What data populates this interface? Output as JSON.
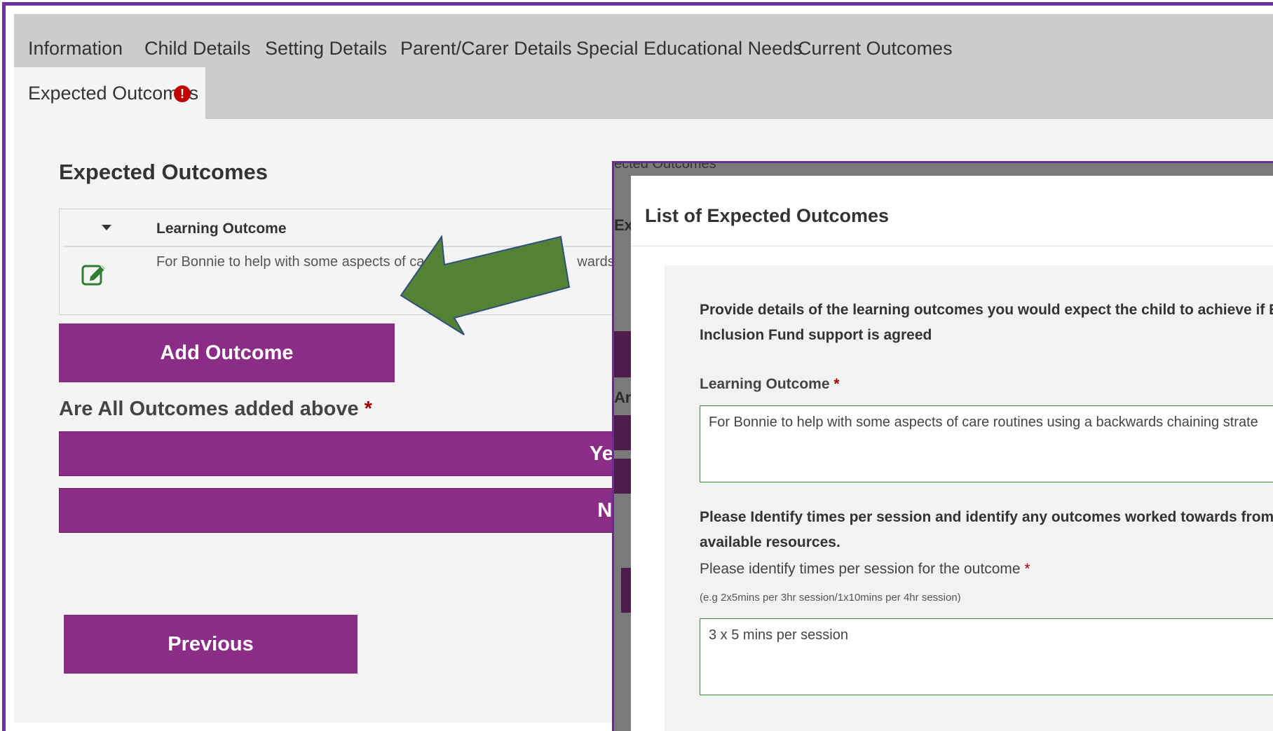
{
  "tabs": {
    "information": "Information",
    "child_details": "Child Details",
    "setting_details": "Setting Details",
    "parent_carer_details": "Parent/Carer Details",
    "special_educational_needs": "Special Educational Needs",
    "current_outcomes": "Current Outcomes",
    "expected_outcomes": "Expected Outcomes"
  },
  "main": {
    "section_title": "Expected Outcomes",
    "table": {
      "column_header": "Learning Outcome",
      "row_text_start": "For Bonnie to help with some aspects of ca",
      "row_text_end": "wards"
    },
    "add_outcome_label": "Add Outcome",
    "question": "Are All Outcomes added above",
    "required_mark": "*",
    "yes_label": "Yes",
    "no_label": "No",
    "previous_label": "Previous"
  },
  "background_peek": {
    "tab_fragment": "ected Outcomes",
    "ex_fragment": "Ex",
    "ar_fragment": "Ar"
  },
  "modal": {
    "title": "List of Expected Outcomes",
    "intro_line1": "Provide details of the learning outcomes you would expect the child to achieve if Earl",
    "intro_line2": "Inclusion Fund support is agreed",
    "learning_outcome_label": "Learning Outcome",
    "learning_outcome_value": "For Bonnie to help with some aspects of care routines using a backwards chaining strate",
    "times_heading_line1": "Please Identify times per session and identify any outcomes worked towards from no",
    "times_heading_line2": "available resources.",
    "times_label": "Please identify times per session for the outcome",
    "times_hint": "(e.g 2x5mins per 3hr session/1x10mins per 4hr session)",
    "times_value": "3 x 5 mins per session"
  },
  "colors": {
    "accent_purple": "#8b2d87",
    "frame_purple": "#7030a0",
    "arrow_green": "#548235",
    "alert_red": "#c00000"
  }
}
